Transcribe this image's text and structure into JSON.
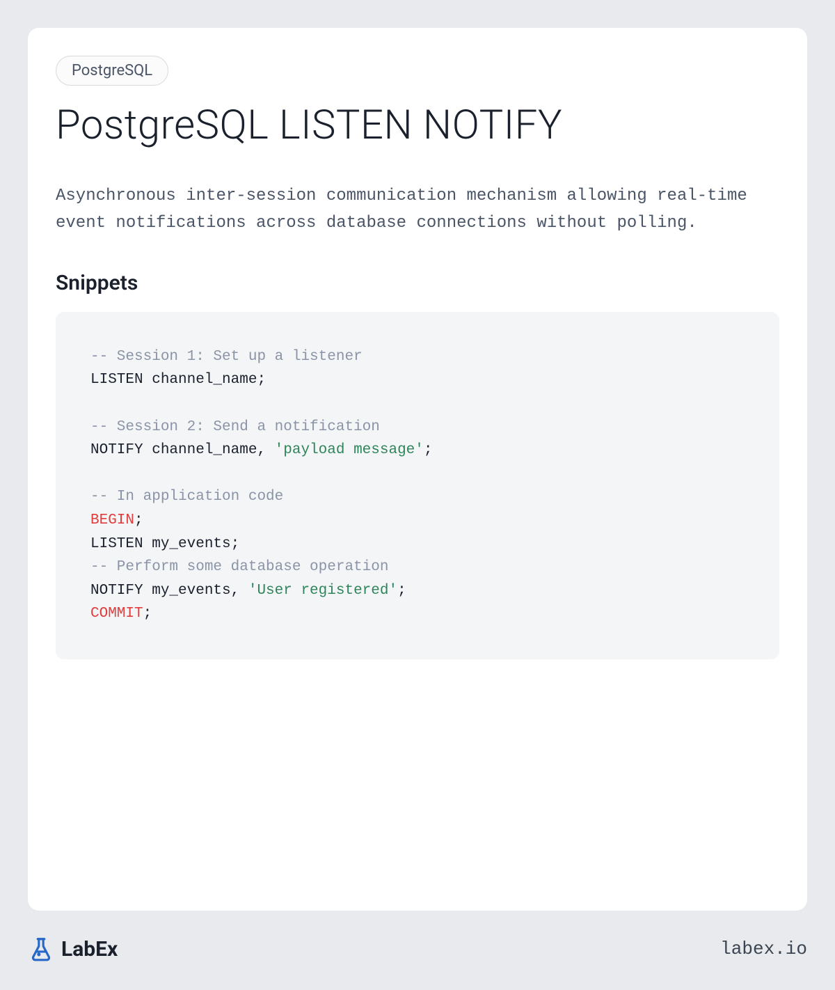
{
  "tag": "PostgreSQL",
  "title": "PostgreSQL LISTEN NOTIFY",
  "description": "Asynchronous inter-session communication mechanism allowing real-time event notifications across database connections without polling.",
  "snippets_heading": "Snippets",
  "code": {
    "tokens": [
      {
        "cls": "c-comment",
        "text": "-- Session 1: Set up a listener"
      },
      {
        "cls": "",
        "text": "\n"
      },
      {
        "cls": "",
        "text": "LISTEN channel_name;"
      },
      {
        "cls": "",
        "text": "\n\n"
      },
      {
        "cls": "c-comment",
        "text": "-- Session 2: Send a notification"
      },
      {
        "cls": "",
        "text": "\n"
      },
      {
        "cls": "",
        "text": "NOTIFY channel_name, "
      },
      {
        "cls": "c-string",
        "text": "'payload message'"
      },
      {
        "cls": "",
        "text": ";"
      },
      {
        "cls": "",
        "text": "\n\n"
      },
      {
        "cls": "c-comment",
        "text": "-- In application code"
      },
      {
        "cls": "",
        "text": "\n"
      },
      {
        "cls": "c-keyword",
        "text": "BEGIN"
      },
      {
        "cls": "",
        "text": ";"
      },
      {
        "cls": "",
        "text": "\n"
      },
      {
        "cls": "",
        "text": "LISTEN my_events;"
      },
      {
        "cls": "",
        "text": "\n"
      },
      {
        "cls": "c-comment",
        "text": "-- Perform some database operation"
      },
      {
        "cls": "",
        "text": "\n"
      },
      {
        "cls": "",
        "text": "NOTIFY my_events, "
      },
      {
        "cls": "c-string",
        "text": "'User registered'"
      },
      {
        "cls": "",
        "text": ";"
      },
      {
        "cls": "",
        "text": "\n"
      },
      {
        "cls": "c-keyword",
        "text": "COMMIT"
      },
      {
        "cls": "",
        "text": ";"
      }
    ]
  },
  "brand": {
    "name": "LabEx",
    "url": "labex.io"
  }
}
